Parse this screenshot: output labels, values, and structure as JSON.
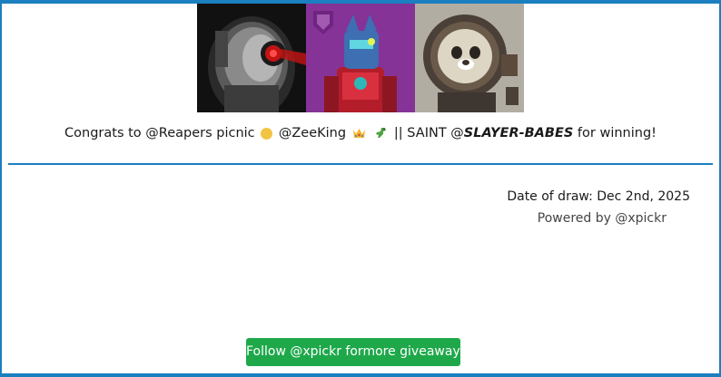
{
  "images": [
    {
      "name": "skull-robot-nft"
    },
    {
      "name": "transformer-robot-nft"
    },
    {
      "name": "astronaut-bear-nft"
    }
  ],
  "congrats": {
    "prefix": "Congrats to @Reapers picnic",
    "mention_2": "@ZeeKing",
    "separator": "|| SAINT @",
    "bold_name": "SLAYER-BABES",
    "suffix": "for winning!"
  },
  "draw_date": "Date of draw: Dec 2nd, 2025",
  "powered_by": "Powered by @xpickr",
  "follow_button": "Follow @xpickr formore giveaways",
  "colors": {
    "border": "#1c7fc0",
    "button": "#1ea84a",
    "emoji_dot": "#f2c443"
  }
}
